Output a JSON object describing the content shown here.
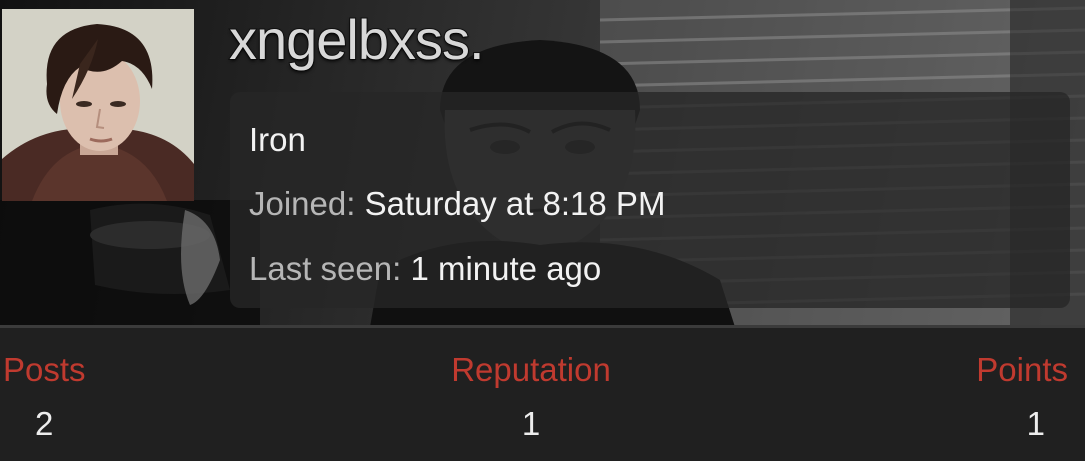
{
  "profile": {
    "username": "xngelbxss.",
    "user_title": "Iron",
    "joined_label": "Joined:",
    "joined_value": "Saturday at 8:18 PM",
    "last_seen_label": "Last seen:",
    "last_seen_value": "1 minute ago"
  },
  "stats": [
    {
      "label": "Posts",
      "value": "2"
    },
    {
      "label": "Reputation",
      "value": "1"
    },
    {
      "label": "Points",
      "value": "1"
    }
  ],
  "colors": {
    "stat_label": "#c03a2f",
    "stat_value": "#ededed",
    "page_background": "#1f1f1f",
    "card_background": "#262626"
  }
}
